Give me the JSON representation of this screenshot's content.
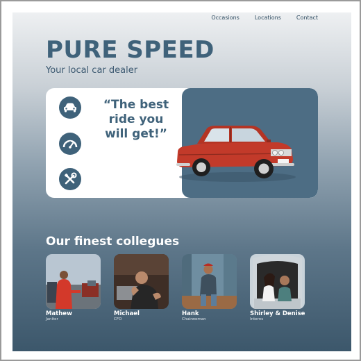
{
  "nav": {
    "items": [
      "Occasions",
      "Locations",
      "Contact"
    ]
  },
  "hero": {
    "title": "PURE SPEED",
    "subtitle": "Your local car dealer"
  },
  "feature": {
    "quote_lines": [
      "“The best",
      "ride you",
      "will get!”"
    ],
    "icons": [
      "car-icon",
      "speedometer-icon",
      "tools-icon"
    ]
  },
  "colleagues": {
    "heading": "Our finest collegues",
    "people": [
      {
        "name": "Mathew",
        "role": "Janitor"
      },
      {
        "name": "Michael",
        "role": "CFO"
      },
      {
        "name": "Hank",
        "role": "Chairwoman"
      },
      {
        "name": "Shirley & Denise",
        "role": "Interns"
      }
    ]
  },
  "colors": {
    "brand": "#3f627a",
    "card_accent": "#4d6d84",
    "car_red": "#c23a2a"
  }
}
